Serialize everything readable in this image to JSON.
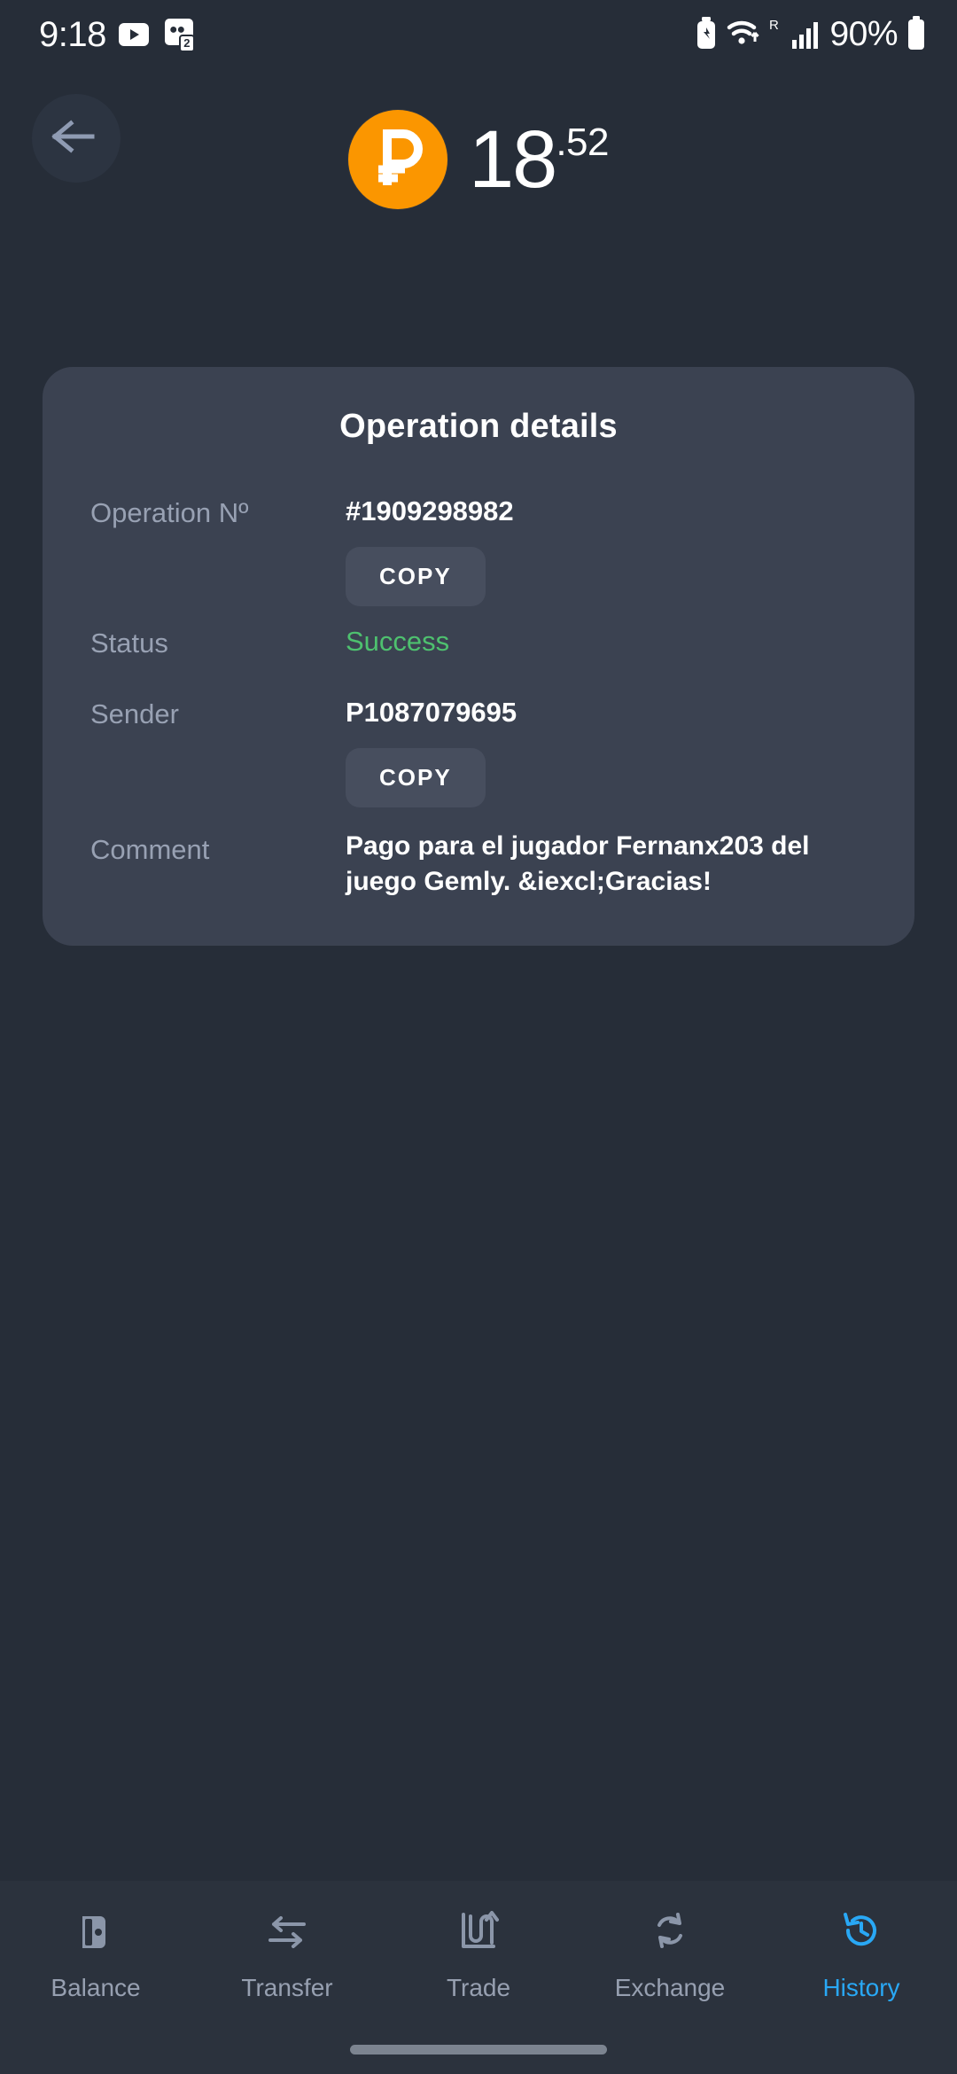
{
  "status_bar": {
    "time": "9:18",
    "notification_icons": [
      "youtube-icon",
      "qq-messages-icon"
    ],
    "qq_badge": "2",
    "right_icons": [
      "battery-saver-icon",
      "wifi-icon",
      "roaming-icon",
      "signal-bars-icon"
    ],
    "roaming_label": "R",
    "battery_percent": "90%"
  },
  "header": {
    "back_icon": "arrow-left-icon"
  },
  "balance": {
    "currency_icon": "ruble-coin-icon",
    "integer": "18",
    "decimal": ".52",
    "coin_color": "#fb9600"
  },
  "card": {
    "title": "Operation details",
    "rows": [
      {
        "label": "Operation º",
        "label_text": "Operation Nº",
        "value": "#1909298982",
        "copy_label": "COPY"
      },
      {
        "label_text": "Status",
        "value": "Success",
        "value_color": "#4ec16f"
      },
      {
        "label_text": "Sender",
        "value": "P1087079695",
        "copy_label": "COPY"
      },
      {
        "label_text": "Comment",
        "value": "Pago para el jugador Fernanx203 del juego Gemly. &iexcl;Gracias!"
      }
    ]
  },
  "bottom_nav": {
    "active_color": "#29a8f5",
    "items": [
      {
        "label": "Balance",
        "icon": "wallet-icon"
      },
      {
        "label": "Transfer",
        "icon": "transfer-arrows-icon"
      },
      {
        "label": "Trade",
        "icon": "trade-chart-icon"
      },
      {
        "label": "Exchange",
        "icon": "exchange-refresh-icon"
      },
      {
        "label": "History",
        "icon": "history-clock-icon"
      }
    ]
  }
}
